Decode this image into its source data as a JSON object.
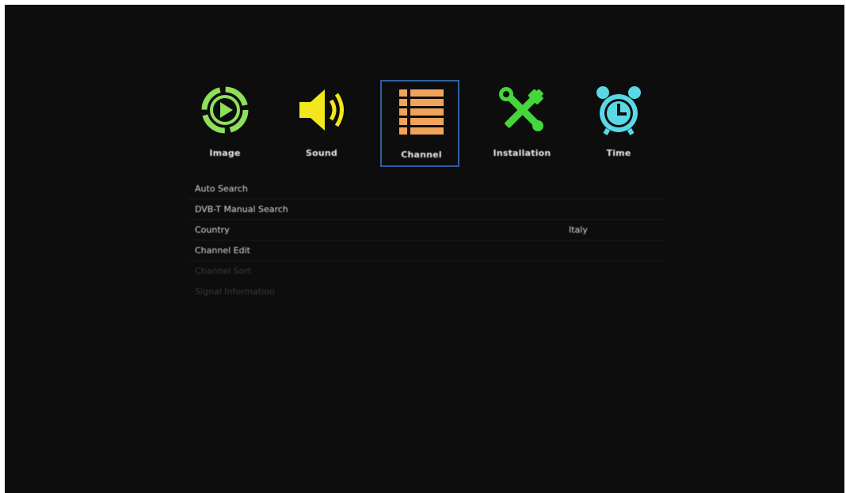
{
  "tabs": [
    {
      "id": "image",
      "label": "Image",
      "icon": "play-circle-icon",
      "color": "#8ee05a"
    },
    {
      "id": "sound",
      "label": "Sound",
      "icon": "speaker-icon",
      "color": "#f2e61c"
    },
    {
      "id": "channel",
      "label": "Channel",
      "icon": "list-icon",
      "color": "#f0a35a",
      "selected": true
    },
    {
      "id": "installation",
      "label": "Installation",
      "icon": "tools-icon",
      "color": "#44d63a"
    },
    {
      "id": "time",
      "label": "Time",
      "icon": "alarm-clock-icon",
      "color": "#5ad8e6"
    }
  ],
  "rows": [
    {
      "label": "Auto Search",
      "value": ""
    },
    {
      "label": "DVB-T Manual Search",
      "value": ""
    },
    {
      "label": "Country",
      "value": "Italy"
    },
    {
      "label": "Channel Edit",
      "value": ""
    },
    {
      "label": "Channel Sort",
      "value": "",
      "dim": true
    },
    {
      "label": "Signal Information",
      "value": "",
      "dim": true
    }
  ],
  "colors": {
    "background": "#0d0d0d",
    "selection_border": "#2f5f9e",
    "text": "#d8d8d8",
    "dim_text": "#3a3a3a"
  }
}
